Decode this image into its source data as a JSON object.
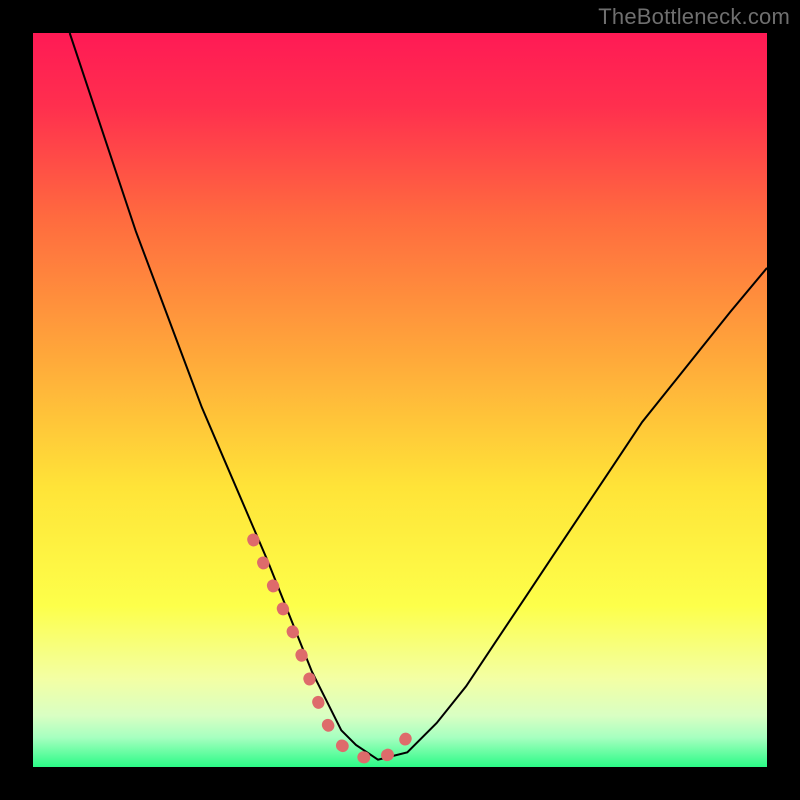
{
  "watermark": "TheBottleneck.com",
  "chart_data": {
    "type": "line",
    "title": "",
    "xlabel": "",
    "ylabel": "",
    "xlim": [
      0,
      100
    ],
    "ylim": [
      0,
      100
    ],
    "background_gradient": {
      "top": "#ff1a4f",
      "mid_upper": "#ff7a3a",
      "mid": "#ffe438",
      "mid_lower": "#f6ff8c",
      "bottom": "#2bfb86"
    },
    "series": [
      {
        "name": "bottleneck-curve",
        "color": "#000000",
        "stroke_width": 2,
        "x": [
          5,
          8,
          11,
          14,
          17,
          20,
          23,
          26,
          29,
          32,
          34,
          36,
          38,
          40,
          42,
          44,
          47,
          51,
          55,
          59,
          63,
          67,
          71,
          75,
          79,
          83,
          87,
          91,
          95,
          100
        ],
        "y": [
          100,
          91,
          82,
          73,
          65,
          57,
          49,
          42,
          35,
          28,
          23,
          18,
          13,
          9,
          5,
          3,
          1,
          2,
          6,
          11,
          17,
          23,
          29,
          35,
          41,
          47,
          52,
          57,
          62,
          68
        ]
      },
      {
        "name": "highlight-valley",
        "color": "#de6b6b",
        "stroke_width": 12,
        "linecap": "round",
        "dash": "1 24",
        "x": [
          30,
          33,
          36,
          38,
          40,
          42,
          44,
          47,
          50,
          52
        ],
        "y": [
          31,
          24,
          17,
          11,
          6,
          3,
          1.5,
          1,
          2.5,
          6
        ]
      }
    ]
  }
}
